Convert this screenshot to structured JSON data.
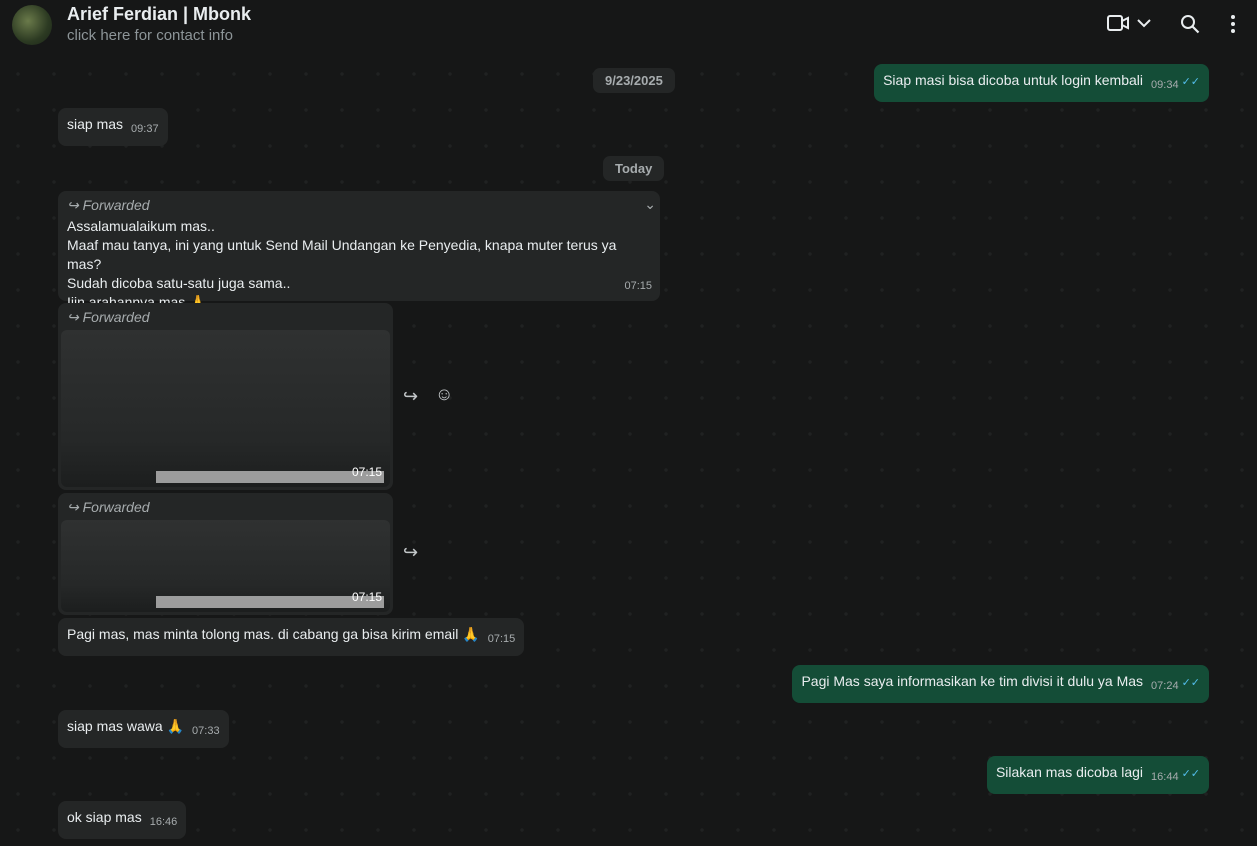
{
  "header": {
    "contact_name": "Arief Ferdian | Mbonk",
    "subtitle": "click here for contact info"
  },
  "dates": {
    "d1": "9/23/2025",
    "d2": "Today"
  },
  "messages": [
    {
      "dir": "out",
      "text": "Siap masi bisa dicoba untuk login kembali",
      "time": "09:34"
    },
    {
      "dir": "in",
      "text": "siap mas",
      "time": "09:37"
    },
    {
      "dir": "in",
      "forwarded": "Forwarded",
      "lines": [
        "Assalamualaikum mas..",
        "Maaf mau tanya, ini yang untuk Send Mail Undangan ke Penyedia, knapa muter terus ya mas?",
        "Sudah dicoba satu-satu juga sama..",
        "Ijin arahannya mas 🙏"
      ],
      "time": "07:15"
    },
    {
      "dir": "in",
      "forwarded": "Forwarded",
      "image": true,
      "time": "07:15"
    },
    {
      "dir": "in",
      "forwarded": "Forwarded",
      "image": true,
      "time": "07:15"
    },
    {
      "dir": "in",
      "text": "Pagi mas, mas minta tolong mas. di cabang ga bisa kirim email 🙏",
      "time": "07:15"
    },
    {
      "dir": "out",
      "text": "Pagi Mas saya informasikan ke tim divisi it dulu ya Mas",
      "time": "07:24"
    },
    {
      "dir": "in",
      "text": "siap mas wawa 🙏",
      "time": "07:33"
    },
    {
      "dir": "out",
      "text": "Silakan mas dicoba lagi",
      "time": "16:44"
    },
    {
      "dir": "in",
      "text": "ok siap mas",
      "time": "16:46"
    }
  ],
  "read_tick": "✓✓",
  "colors": {
    "incoming": "#242626",
    "outgoing": "#144d37",
    "tick": "#53bdeb"
  }
}
